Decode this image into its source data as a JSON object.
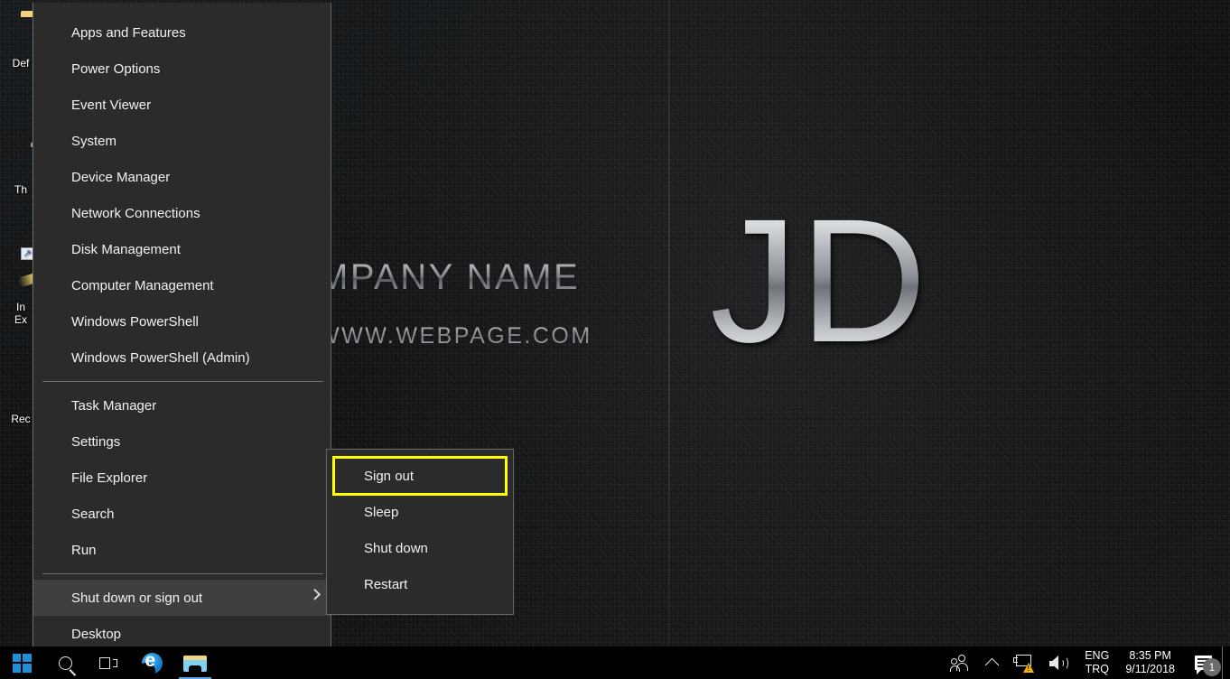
{
  "wallpaper": {
    "company_name": "MPANY NAME",
    "website": "WWW.WEBPAGE.COM",
    "initials": "JD"
  },
  "desktop_icons": [
    {
      "name": "Def",
      "icon": "folder-icon"
    },
    {
      "name": "Th",
      "icon": "this-pc-icon"
    },
    {
      "name": "In",
      "name2": "Ex",
      "icon": "internet-explorer-icon"
    },
    {
      "name": "Rec",
      "icon": "recycle-bin-icon"
    }
  ],
  "winx_menu": {
    "groups": [
      {
        "items": [
          {
            "label": "Apps and Features"
          },
          {
            "label": "Power Options"
          },
          {
            "label": "Event Viewer"
          },
          {
            "label": "System"
          },
          {
            "label": "Device Manager"
          },
          {
            "label": "Network Connections"
          },
          {
            "label": "Disk Management"
          },
          {
            "label": "Computer Management"
          },
          {
            "label": "Windows PowerShell"
          },
          {
            "label": "Windows PowerShell (Admin)"
          }
        ]
      },
      {
        "items": [
          {
            "label": "Task Manager"
          },
          {
            "label": "Settings"
          },
          {
            "label": "File Explorer"
          },
          {
            "label": "Search"
          },
          {
            "label": "Run"
          }
        ]
      },
      {
        "items": [
          {
            "label": "Shut down or sign out",
            "selected": true,
            "has_submenu": true
          },
          {
            "label": "Desktop"
          }
        ]
      }
    ]
  },
  "submenu": {
    "items": [
      {
        "label": "Sign out",
        "highlighted": true
      },
      {
        "label": "Sleep"
      },
      {
        "label": "Shut down"
      },
      {
        "label": "Restart"
      }
    ]
  },
  "taskbar": {
    "start_label": "Start",
    "search_label": "Search",
    "taskview_label": "Task View",
    "edge_label": "Microsoft Edge",
    "file_explorer_label": "File Explorer",
    "tray": {
      "people_label": "People",
      "show_hidden_label": "Show hidden icons",
      "network_label": "Network",
      "volume_label": "Speakers",
      "language_line1": "ENG",
      "language_line2": "TRQ",
      "time": "8:35 PM",
      "date": "9/11/2018",
      "notification_count": "1"
    }
  },
  "colors": {
    "menu_bg": "#2b2b2b",
    "menu_hover": "#3f3f3f",
    "menu_border": "#686868",
    "highlight_outline": "#ffff00",
    "taskbar_bg": "#000000",
    "accent": "#1f8fd8"
  }
}
